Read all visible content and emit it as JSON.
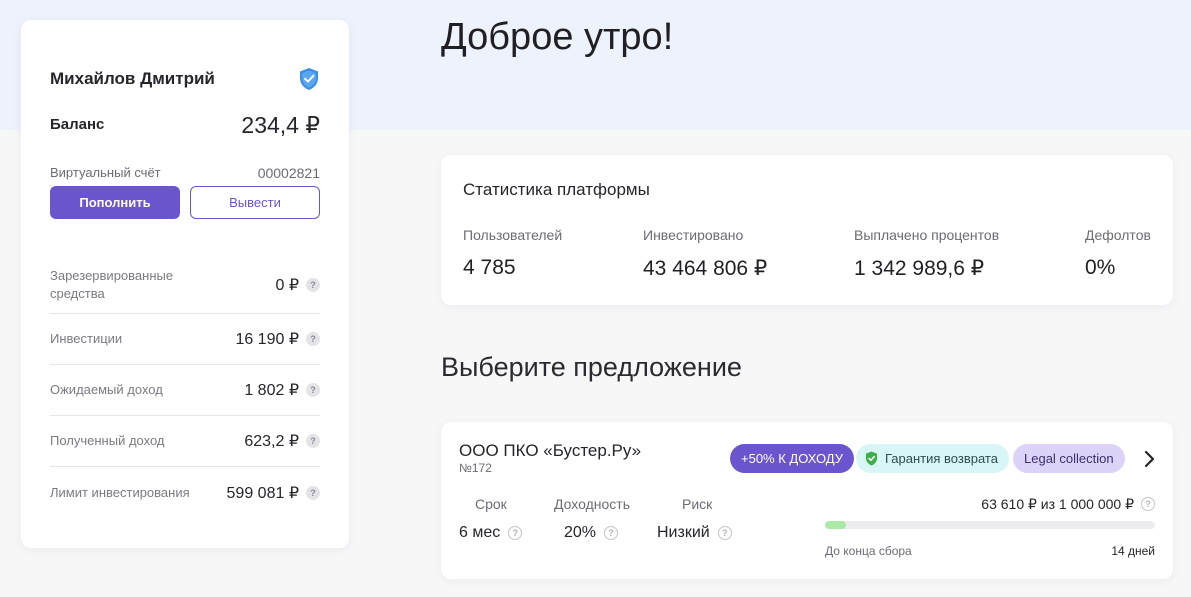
{
  "greeting": "Доброе утро!",
  "profile": {
    "name": "Михайлов Дмитрий",
    "balance_label": "Баланс",
    "balance_value": "234,4 ₽",
    "virtual_account_label": "Виртуальный счёт",
    "virtual_account_value": "00002821",
    "topup_button": "Пополнить",
    "withdraw_button": "Вывести",
    "stats": [
      {
        "label": "Зарезервированные средства",
        "value": "0 ₽"
      },
      {
        "label": "Инвестиции",
        "value": "16 190 ₽"
      },
      {
        "label": "Ожидаемый доход",
        "value": "1 802 ₽"
      },
      {
        "label": "Полученный доход",
        "value": "623,2 ₽"
      },
      {
        "label": "Лимит инвестирования",
        "value": "599 081 ₽"
      }
    ],
    "help_glyph": "?"
  },
  "platform": {
    "title": "Статистика платформы",
    "metrics": [
      {
        "label": "Пользователей",
        "value": "4 785"
      },
      {
        "label": "Инвестировано",
        "value": "43 464 806 ₽"
      },
      {
        "label": "Выплачено процентов",
        "value": "1 342 989,6 ₽"
      },
      {
        "label": "Дефолтов",
        "value": "0%"
      }
    ]
  },
  "offers_section_title": "Выберите предложение",
  "offer": {
    "name": "ООО ПКО «Бустер.Ру»",
    "number": "№172",
    "badges": {
      "income": "+50% К ДОХОДУ",
      "guarantee": "Гарантия возврата",
      "legal": "Legal collection"
    },
    "terms": [
      {
        "label": "Срок",
        "value": "6 мес"
      },
      {
        "label": "Доходность",
        "value": "20%"
      },
      {
        "label": "Риск",
        "value": "Низкий"
      }
    ],
    "raised_text": "63 610 ₽ из 1 000 000 ₽",
    "raised_fraction": 0.0636,
    "deadline_label": "До конца сбора",
    "deadline_value": "14 дней"
  },
  "colors": {
    "accent": "#6b55cf",
    "progress": "#a9eaa7",
    "shield": "#3a8ee6",
    "guarantee_icon": "#3fae4a"
  },
  "icons": [
    "verified-shield-icon",
    "help-icon",
    "shield-check-icon",
    "chevron-right-icon"
  ]
}
